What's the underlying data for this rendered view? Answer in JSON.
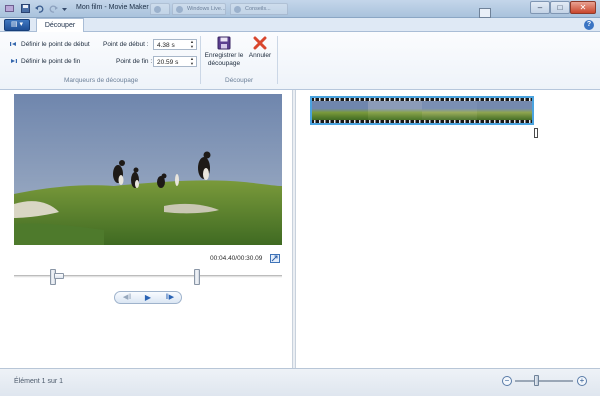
{
  "window": {
    "title": "Mon film - Movie Maker",
    "background_tabs": [
      "",
      "Windows Live...",
      "Conseils..."
    ]
  },
  "ribbon": {
    "tab_active": "Découper",
    "set_start_label": "Définir le point de début",
    "set_end_label": "Définir le point de fin",
    "start_point_label": "Point de début :",
    "start_point_value": "4.38 s",
    "end_point_label": "Point de fin :",
    "end_point_value": "20.59 s",
    "group_markers_label": "Marqueurs de découpage",
    "save_trim_label_1": "Enregistrer le",
    "save_trim_label_2": "découpage",
    "cancel_label": "Annuler",
    "group_trim_label": "Découper"
  },
  "preview": {
    "timecode": "00:04.40/00:30.09",
    "trim_start_fraction": 0.146,
    "trim_end_fraction": 0.684,
    "playhead_fraction": 0.148
  },
  "status": {
    "item_text": "Élément 1 sur 1",
    "zoom_fraction": 0.38
  },
  "colors": {
    "accent": "#4aa3df",
    "close_red": "#d9472e",
    "save_purple": "#5b3f8f"
  }
}
